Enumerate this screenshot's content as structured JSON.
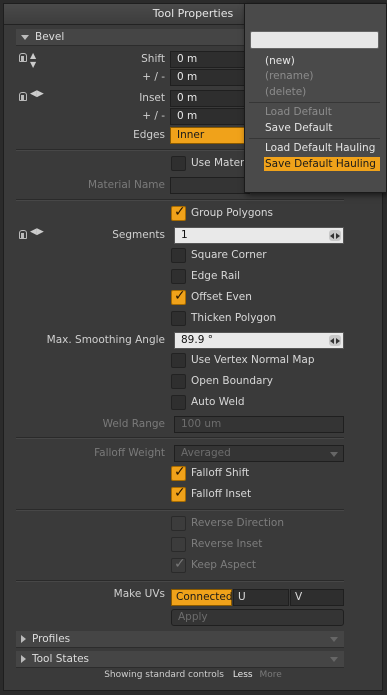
{
  "window": {
    "title": "Tool Properties"
  },
  "bevel": {
    "section": "Bevel",
    "shift_label": "Shift",
    "shift_value": "0 m",
    "shift_pm_label": "+ / -",
    "shift_pm_value": "0 m",
    "inset_label": "Inset",
    "inset_value": "0 m",
    "inset_pm_label": "+ / -",
    "inset_pm_value": "0 m",
    "edges_label": "Edges",
    "edges_value": "Inner",
    "use_material": "Use Materia",
    "material_name_label": "Material Name",
    "group_polygons": "Group Polygons",
    "segments_label": "Segments",
    "segments_value": "1",
    "square_corner": "Square Corner",
    "edge_rail": "Edge Rail",
    "offset_even": "Offset Even",
    "thicken_polygon": "Thicken Polygon",
    "max_smoothing_label": "Max. Smoothing Angle",
    "max_smoothing_value": "89.9 °",
    "use_vertex_normal_map": "Use Vertex Normal Map",
    "open_boundary": "Open Boundary",
    "auto_weld": "Auto Weld",
    "weld_range_label": "Weld Range",
    "weld_range_value": "100 um",
    "falloff_weight_label": "Falloff Weight",
    "falloff_weight_value": "Averaged",
    "falloff_shift": "Falloff Shift",
    "falloff_inset": "Falloff Inset",
    "reverse_direction": "Reverse Direction",
    "reverse_inset": "Reverse Inset",
    "keep_aspect": "Keep Aspect",
    "make_uvs_label": "Make UVs",
    "make_uvs_options": [
      "Connected",
      "U",
      "V"
    ],
    "apply_label": "Apply"
  },
  "sections": {
    "profiles": "Profiles",
    "tool_states": "Tool States"
  },
  "footer": {
    "showing": "Showing standard controls",
    "less": "Less",
    "more": "More"
  },
  "preset_menu": {
    "items": {
      "new": "(new)",
      "rename": "(rename)",
      "delete": "(delete)",
      "load_default": "Load Default",
      "save_default": "Save Default",
      "load_default_hauling": "Load Default Hauling",
      "save_default_hauling": "Save Default Hauling"
    }
  },
  "colors": {
    "accent": "#f0a21a",
    "panel": "#3a3a3a",
    "background": "#2b2b2b"
  }
}
